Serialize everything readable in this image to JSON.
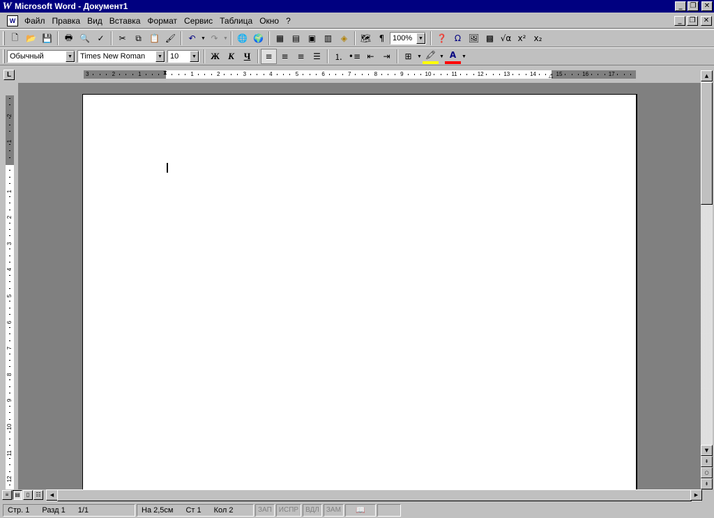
{
  "window": {
    "title": "Microsoft Word - Документ1",
    "logo_letter": "W",
    "minimize": "_",
    "restore": "❐",
    "close": "✕"
  },
  "menu": {
    "items": [
      "Файл",
      "Правка",
      "Вид",
      "Вставка",
      "Формат",
      "Сервис",
      "Таблица",
      "Окно",
      "?"
    ]
  },
  "toolbar_standard": {
    "zoom": "100%",
    "icons": [
      "new-icon",
      "open-icon",
      "save-icon",
      "print-icon",
      "print-preview-icon",
      "spelling-icon",
      "cut-icon",
      "copy-icon",
      "paste-icon",
      "format-painter-icon",
      "undo-icon",
      "redo-icon",
      "hyperlink-icon",
      "web-toolbar-icon",
      "tables-borders-icon",
      "insert-table-icon",
      "insert-excel-icon",
      "columns-icon",
      "drawing-icon",
      "document-map-icon",
      "show-paragraph-icon",
      "help-icon",
      "symbol-icon",
      "picture-icon",
      "grid-icon",
      "equation-icon",
      "superscript-icon",
      "subscript-icon"
    ]
  },
  "toolbar_formatting": {
    "style": "Обычный",
    "font": "Times New Roman",
    "size": "10",
    "bold_label": "Ж",
    "italic_label": "К",
    "underline_label": "Ч",
    "highlight_color": "#ffff00",
    "font_color": "#ff0000",
    "font_color_letter": "A"
  },
  "ruler": {
    "left_labels": [
      "3",
      "2",
      "1"
    ],
    "right_labels": [
      "1",
      "2",
      "3",
      "4",
      "5",
      "6",
      "7",
      "8",
      "9",
      "10",
      "11",
      "12",
      "13",
      "14",
      "15",
      "16",
      "17"
    ],
    "vertical_labels_top": [
      "2",
      "1"
    ],
    "vertical_labels": [
      "1",
      "2",
      "3",
      "4",
      "5",
      "6",
      "7",
      "8",
      "9",
      "10",
      "11",
      "12"
    ],
    "tab_selector": "L"
  },
  "status": {
    "page": "Стр. 1",
    "section": "Разд 1",
    "page_of": "1/1",
    "at": "На 2,5см",
    "line": "Ст 1",
    "col": "Кол 2",
    "rec": "ЗАП",
    "trk": "ИСПР",
    "ext": "ВДЛ",
    "ovr": "ЗАМ"
  }
}
